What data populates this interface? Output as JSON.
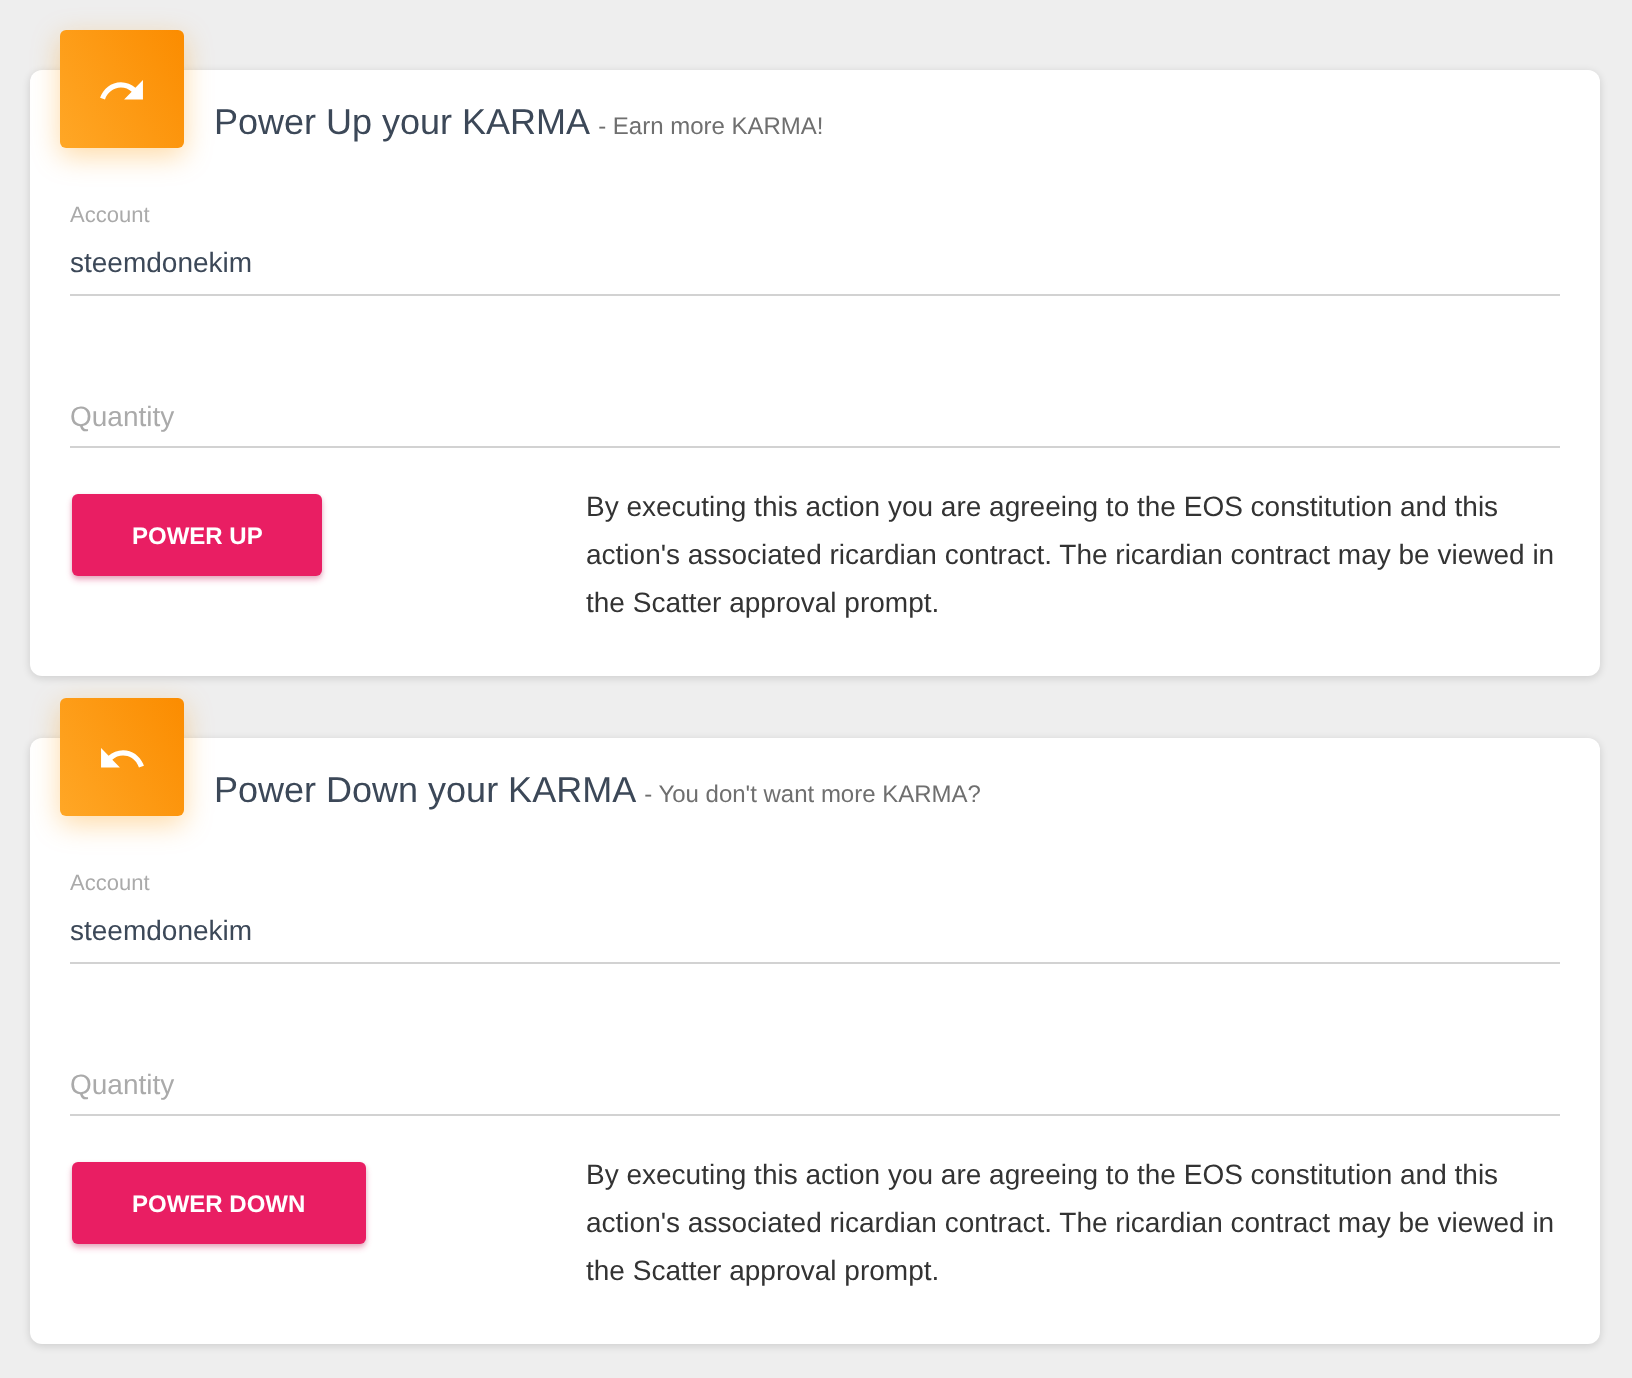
{
  "sections": [
    {
      "kind": "up",
      "title": "Power Up your KARMA",
      "subtitle": "- Earn more KARMA!",
      "fields": [
        {
          "label": "Account",
          "value": "steemdonekim"
        },
        {
          "placeholder": "Quantity"
        }
      ],
      "button": "POWER UP",
      "notice": "By executing this action you are agreeing to the EOS constitution and this action's associated ricardian contract. The ricardian contract may be viewed in the Scatter approval prompt."
    },
    {
      "kind": "down",
      "title": "Power Down your KARMA",
      "subtitle": "- You don't want more KARMA?",
      "fields": [
        {
          "label": "Account",
          "value": "steemdonekim"
        },
        {
          "placeholder": "Quantity"
        }
      ],
      "button": "POWER DOWN",
      "notice": "By executing this action you are agreeing to the EOS constitution and this action's associated ricardian contract. The ricardian contract may be viewed in the Scatter approval prompt."
    }
  ]
}
